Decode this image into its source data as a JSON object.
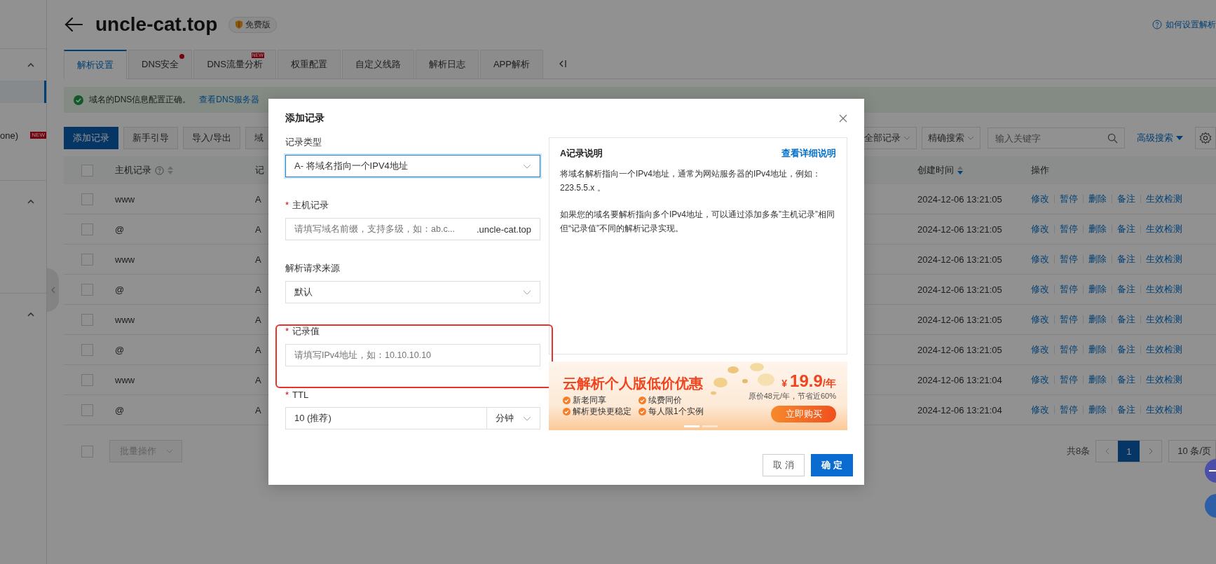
{
  "sidebar": {
    "groups": [
      {
        "expanded": true,
        "items": [
          {
            "selected": true
          },
          {
            "label": "one)",
            "badge": "NEW",
            "selected": false
          }
        ]
      },
      {
        "expanded": true
      },
      {
        "expanded": true
      }
    ]
  },
  "header": {
    "title": "uncle-cat.top",
    "badge": "免费版",
    "help_link": "如何设置解析"
  },
  "tabs": [
    {
      "label": "解析设置",
      "selected": true
    },
    {
      "label": "DNS安全",
      "selected": false,
      "dot": true
    },
    {
      "label": "DNS流量分析",
      "selected": false,
      "badge": "NEW"
    },
    {
      "label": "权重配置",
      "selected": false
    },
    {
      "label": "自定义线路",
      "selected": false
    },
    {
      "label": "解析日志",
      "selected": false
    },
    {
      "label": "APP解析",
      "selected": false
    }
  ],
  "alert": {
    "message": "域名的DNS信息配置正确。",
    "link": "查看DNS服务器"
  },
  "toolbar": {
    "buttons": [
      {
        "label": "添加记录",
        "primary": true
      },
      {
        "label": "新手引导",
        "primary": false
      },
      {
        "label": "导入/导出",
        "primary": false
      },
      {
        "label": "域",
        "primary": false
      }
    ],
    "filter": "全部记录",
    "match": "精确搜索",
    "search_placeholder": "输入关键字",
    "advanced": "高级搜索"
  },
  "table": {
    "select_all_checked": false,
    "columns": [
      "主机记录",
      "记",
      "创建时间",
      "操作"
    ],
    "rows": [
      {
        "checked": false,
        "host": "www",
        "type": "A",
        "created": "2024-12-06 13:21:05",
        "actions": [
          "修改",
          "暂停",
          "删除",
          "备注",
          "生效检测"
        ]
      },
      {
        "checked": false,
        "host": "@",
        "type": "A",
        "created": "2024-12-06 13:21:05",
        "actions": [
          "修改",
          "暂停",
          "删除",
          "备注",
          "生效检测"
        ]
      },
      {
        "checked": false,
        "host": "www",
        "type": "A",
        "created": "2024-12-06 13:21:05",
        "actions": [
          "修改",
          "暂停",
          "删除",
          "备注",
          "生效检测"
        ]
      },
      {
        "checked": false,
        "host": "@",
        "type": "A",
        "created": "2024-12-06 13:21:05",
        "actions": [
          "修改",
          "暂停",
          "删除",
          "备注",
          "生效检测"
        ]
      },
      {
        "checked": false,
        "host": "www",
        "type": "A",
        "created": "2024-12-06 13:21:05",
        "actions": [
          "修改",
          "暂停",
          "删除",
          "备注",
          "生效检测"
        ]
      },
      {
        "checked": false,
        "host": "@",
        "type": "A",
        "created": "2024-12-06 13:21:05",
        "actions": [
          "修改",
          "暂停",
          "删除",
          "备注",
          "生效检测"
        ]
      },
      {
        "checked": false,
        "host": "www",
        "type": "A",
        "created": "2024-12-06 13:21:04",
        "actions": [
          "修改",
          "暂停",
          "删除",
          "备注",
          "生效检测"
        ]
      },
      {
        "checked": false,
        "host": "@",
        "type": "A",
        "created": "2024-12-06 13:21:04",
        "actions": [
          "修改",
          "暂停",
          "删除",
          "备注",
          "生效检测"
        ]
      }
    ]
  },
  "footer": {
    "checked": false,
    "bulk": "批量操作",
    "total": "共8条",
    "pages": [
      {
        "label": "1",
        "selected": true
      }
    ],
    "page_size": "10 条/页"
  },
  "dialog": {
    "title": "添加记录",
    "required_mark": "*",
    "fields": [
      {
        "kind": "select",
        "label": "记录类型",
        "required": false,
        "value": "A- 将域名指向一个IPV4地址",
        "focused": true
      },
      {
        "kind": "suffix",
        "label": "主机记录",
        "required": true,
        "placeholder": "请填写域名前缀，支持多级，如：ab.c...",
        "suffix": ".uncle-cat.top",
        "focused": false
      },
      {
        "kind": "select",
        "label": "解析请求来源",
        "required": false,
        "value": "默认",
        "focused": false
      },
      {
        "kind": "input",
        "label": "记录值",
        "required": true,
        "placeholder": "请填写IPv4地址，如：10.10.10.10",
        "focused": false,
        "highlighted": true
      },
      {
        "kind": "ttl",
        "label": "TTL",
        "required": true,
        "value": "10 (推荐)",
        "unit": "分钟",
        "focused": false
      }
    ],
    "help": {
      "title": "A记录说明",
      "link": "查看详细说明",
      "paragraphs": [
        "将域名解析指向一个IPv4地址，通常为网站服务器的IPv4地址，例如：223.5.5.x 。",
        "如果您的域名要解析指向多个IPv4地址，可以通过添加多条”主机记录”相同但“记录值”不同的解析记录实现。"
      ]
    },
    "promo": {
      "title": "云解析个人版低价优惠",
      "features": [
        "新老同享",
        "续费同价",
        "解析更快更稳定",
        "每人限1个实例"
      ],
      "currency": "¥",
      "price": "19.9",
      "per": "/年",
      "original": "原价48元/年，节省近60%",
      "button": "立即购买",
      "slides": [
        {
          "selected": true
        },
        {
          "selected": false
        }
      ]
    },
    "buttons": [
      {
        "label": "取 消",
        "primary": false
      },
      {
        "label": "确 定",
        "primary": true
      }
    ]
  }
}
